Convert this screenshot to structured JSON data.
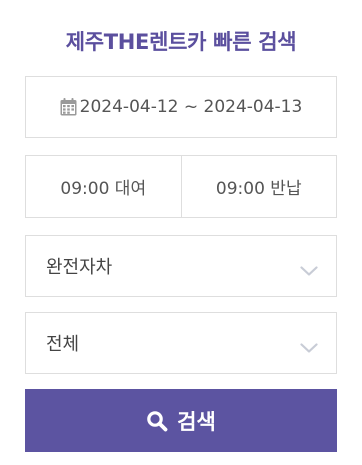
{
  "header": {
    "title": "제주THE렌트카 빠른 검색"
  },
  "date_range": {
    "icon": "calendar-icon",
    "value": "2024-04-12 ~ 2024-04-13"
  },
  "times": {
    "pickup": "09:00 대여",
    "return": "09:00 반납"
  },
  "car_type_select": {
    "selected": "완전자차",
    "icon": "chevron-down-icon"
  },
  "category_select": {
    "selected": "전체",
    "icon": "chevron-down-icon"
  },
  "search_button": {
    "icon": "search-icon",
    "label": "검색"
  },
  "colors": {
    "title": "#5b4f9e",
    "button_bg": "#5c54a1",
    "border": "#dedede",
    "chevron": "#c8ccd6"
  }
}
